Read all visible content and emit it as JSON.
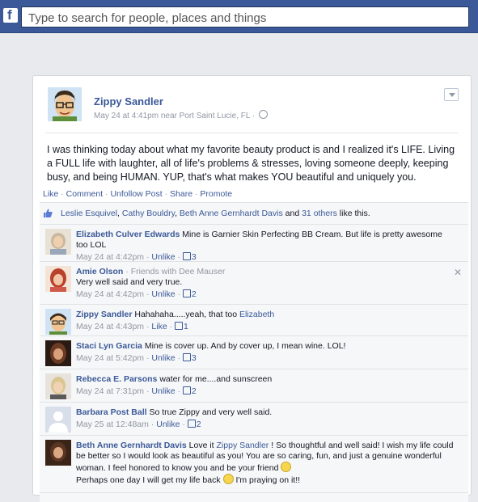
{
  "search": {
    "placeholder": "Type to search for people, places and things"
  },
  "post": {
    "author": "Zippy Sandler",
    "meta": "May 24 at 4:41pm near Port Saint Lucie, FL ·",
    "text": "I was thinking today about what my favorite beauty product is and I realized it's LIFE. Living a FULL life with laughter, all of life's problems & stresses, loving someone deeply, keeping busy, and being HUMAN. YUP, that's what makes YOU beautiful and uniquely you.",
    "actions": {
      "like": "Like",
      "comment": "Comment",
      "unfollow": "Unfollow Post",
      "share": "Share",
      "promote": "Promote"
    }
  },
  "likes": {
    "names": [
      "Leslie Esquivel",
      "Cathy Bouldry",
      "Beth Anne Gernhardt Davis"
    ],
    "others": "31 others",
    "suffix": "like this."
  },
  "comments": [
    {
      "name": "Elizabeth Culver Edwards",
      "text": "Mine is Garnier Skin Perfecting BB Cream. But life is pretty awesome too LOL",
      "time": "May 24 at 4:42pm",
      "action": "Unlike",
      "count": "3"
    },
    {
      "name": "Amie Olson",
      "sub": "Friends with Dee Mauser",
      "text": "Very well said and very true.",
      "time": "May 24 at 4:42pm",
      "action": "Unlike",
      "count": "2"
    },
    {
      "name": "Zippy Sandler",
      "text": "Hahahaha.....yeah, that too",
      "tag": "Elizabeth",
      "time": "May 24 at 4:43pm",
      "action": "Like",
      "count": "1"
    },
    {
      "name": "Staci Lyn Garcia",
      "text": "Mine is cover up. And by cover up, I mean wine. LOL!",
      "time": "May 24 at 5:42pm",
      "action": "Unlike",
      "count": "3"
    },
    {
      "name": "Rebecca E. Parsons",
      "text": "water for me....and sunscreen",
      "time": "May 24 at 7:31pm",
      "action": "Unlike",
      "count": "2"
    },
    {
      "name": "Barbara Post Ball",
      "text": "So true Zippy and very well said.",
      "time": "May 25 at 12:48am",
      "action": "Unlike",
      "count": "2"
    },
    {
      "name": "Beth Anne Gernhardt Davis",
      "pre": "Love it",
      "tag": "Zippy Sandler",
      "text": "! So thoughtful and well said! I wish my life could be better so I would look as beautiful as you! You are so caring, fun, and just a genuine wonderful woman. I feel honored to know you and be your friend",
      "text2": "Perhaps one day I will get my life back",
      "text3": "I'm praying on it!!"
    }
  ]
}
